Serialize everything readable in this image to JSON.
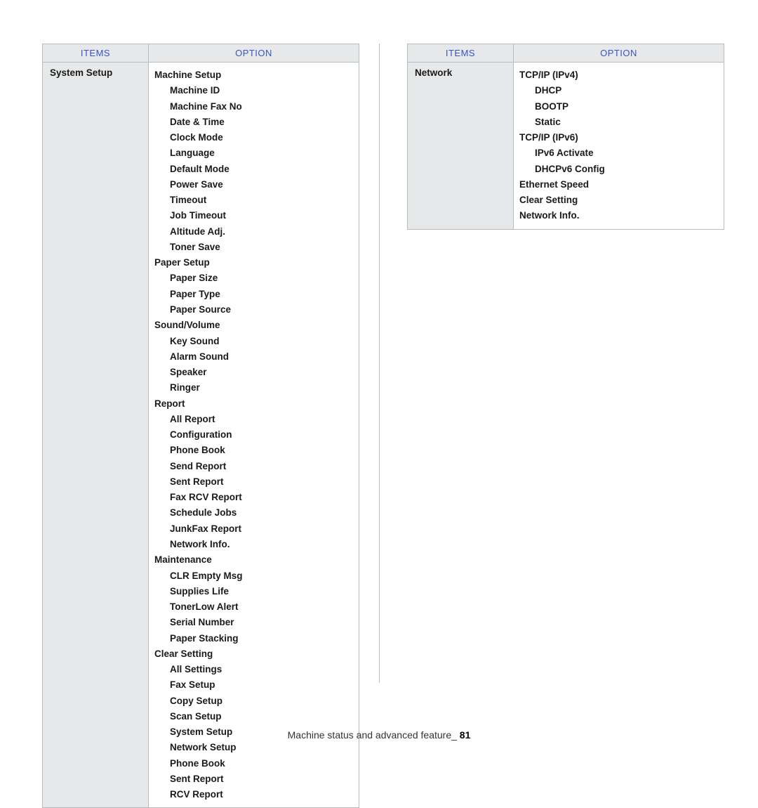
{
  "headers": {
    "items": "ITEMS",
    "option": "OPTION"
  },
  "left": {
    "item": "System Setup",
    "groups": [
      {
        "title": "Machine Setup",
        "children": [
          "Machine ID",
          "Machine Fax No",
          "Date & Time",
          "Clock Mode",
          "Language",
          "Default Mode",
          "Power Save",
          "Timeout",
          "Job Timeout",
          "Altitude Adj.",
          "Toner Save"
        ]
      },
      {
        "title": "Paper Setup",
        "children": [
          "Paper Size",
          "Paper Type",
          "Paper Source"
        ]
      },
      {
        "title": "Sound/Volume",
        "children": [
          "Key Sound",
          "Alarm Sound",
          "Speaker",
          "Ringer"
        ]
      },
      {
        "title": "Report",
        "children": [
          "All Report",
          "Configuration",
          "Phone Book",
          "Send Report",
          "Sent Report",
          "Fax RCV Report",
          "Schedule Jobs",
          "JunkFax Report",
          "Network Info."
        ]
      },
      {
        "title": "Maintenance",
        "children": [
          "CLR Empty Msg",
          "Supplies Life",
          "TonerLow Alert",
          "Serial Number",
          "Paper Stacking"
        ]
      },
      {
        "title": "Clear Setting",
        "children": [
          "All Settings",
          "Fax Setup",
          "Copy Setup",
          "Scan Setup",
          "System Setup",
          "Network Setup",
          "Phone Book",
          "Sent Report",
          "RCV Report"
        ]
      }
    ]
  },
  "right": {
    "item": "Network",
    "lines": [
      {
        "text": "TCP/IP (IPv4)",
        "indent": 0
      },
      {
        "text": "DHCP",
        "indent": 1
      },
      {
        "text": "BOOTP",
        "indent": 1
      },
      {
        "text": "Static",
        "indent": 1
      },
      {
        "text": "TCP/IP (IPv6)",
        "indent": 0
      },
      {
        "text": "IPv6 Activate",
        "indent": 1
      },
      {
        "text": "DHCPv6 Config",
        "indent": 1
      },
      {
        "text": "Ethernet Speed",
        "indent": 0
      },
      {
        "text": "Clear Setting",
        "indent": 0
      },
      {
        "text": "Network Info.",
        "indent": 0
      }
    ]
  },
  "footer": {
    "text": "Machine status and advanced feature_ ",
    "page": "81"
  }
}
